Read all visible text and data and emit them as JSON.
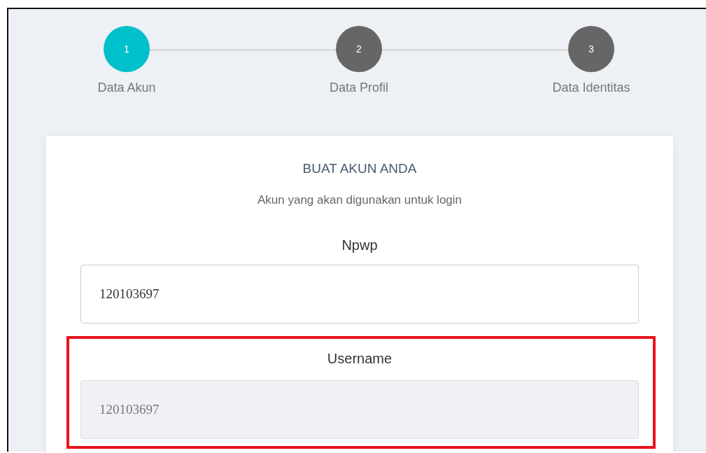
{
  "steps": [
    {
      "number": "1",
      "label": "Data Akun",
      "selected": true
    },
    {
      "number": "2",
      "label": "Data Profil",
      "selected": false
    },
    {
      "number": "3",
      "label": "Data Identitas",
      "selected": false
    }
  ],
  "form": {
    "title": "BUAT AKUN ANDA",
    "subtitle": "Akun yang akan digunakan untuk login",
    "fields": [
      {
        "label": "Npwp",
        "value": "120103697",
        "disabled": false,
        "highlighted": false
      },
      {
        "label": "Username",
        "value": "120103697",
        "disabled": true,
        "highlighted": true
      }
    ]
  }
}
